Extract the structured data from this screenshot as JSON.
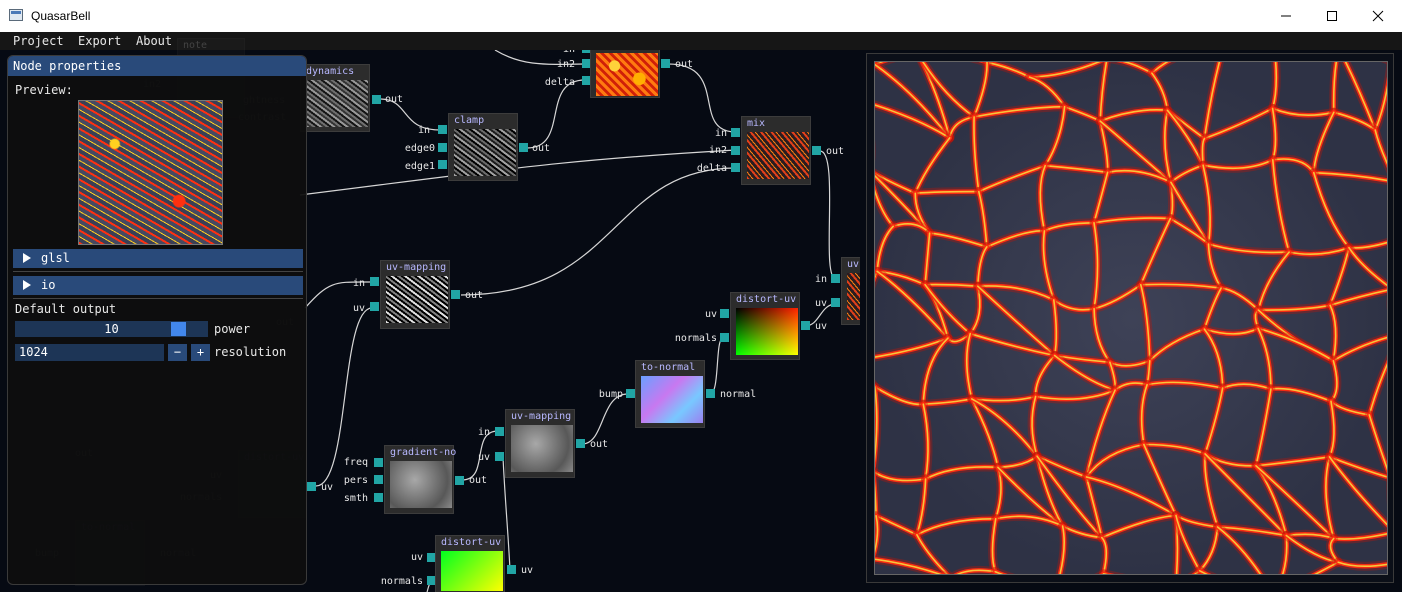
{
  "window": {
    "title": "QuasarBell"
  },
  "menu": [
    "Project",
    "Export",
    "About"
  ],
  "colors": {
    "accent": "#294a7a",
    "port": "#21a5a5",
    "node_title": "#b8b8ff",
    "canvas": "#060a13"
  },
  "props": {
    "title": "Node properties",
    "preview_label": "Preview:",
    "sections": [
      "glsl",
      "io"
    ],
    "default_output_label": "Default output",
    "power": {
      "value": "10",
      "label": "power"
    },
    "resolution": {
      "value": "1024",
      "label": "resolution",
      "minus": "−",
      "plus": "+"
    }
  },
  "nodes": {
    "dynamics": {
      "title": "dynamics",
      "out": "out"
    },
    "clamp": {
      "title": "clamp",
      "in": "in",
      "edge0": "edge0",
      "edge1": "edge1",
      "out": "out"
    },
    "top_mix": {
      "in_top": "in",
      "in2": "in2",
      "delta": "delta",
      "out": "out"
    },
    "mix": {
      "title": "mix",
      "in": "in",
      "in2": "in2",
      "delta": "delta",
      "out": "out"
    },
    "uv_mapping_1": {
      "title": "uv-mapping",
      "in": "in",
      "uv": "uv",
      "out": "out"
    },
    "distort_uv_1": {
      "title": "distort-uv",
      "uv": "uv",
      "normals": "normals",
      "out": "uv"
    },
    "to_normal": {
      "title": "to-normal",
      "bump": "bump",
      "out": "normal"
    },
    "uv_mapping_2": {
      "title": "uv-mapping",
      "in": "in",
      "uv": "uv",
      "out": "out"
    },
    "gradient_noise": {
      "title": "gradient-no",
      "freq": "freq",
      "pers": "pers",
      "smth": "smth",
      "out": "out"
    },
    "distort_uv_2": {
      "title": "distort-uv",
      "uv": "uv",
      "normals": "normals",
      "out": "uv"
    },
    "uv_edge": {
      "title": "uv-",
      "in": "in",
      "uv": "uv"
    },
    "uv_side": {
      "out": "uv"
    }
  },
  "ghosts": {
    "tl_title": "note",
    "tl_in2": "in2",
    "tl_tightness": "ghtness",
    "tl_contrast": "contrast",
    "mid_out": "out",
    "low_out": "out",
    "distort_title": "distort-uv",
    "distort_uv": "uv",
    "distort_normals": "normals",
    "normal_title": "to-normal",
    "normal_bump": "bump",
    "normal_out": "normal"
  }
}
